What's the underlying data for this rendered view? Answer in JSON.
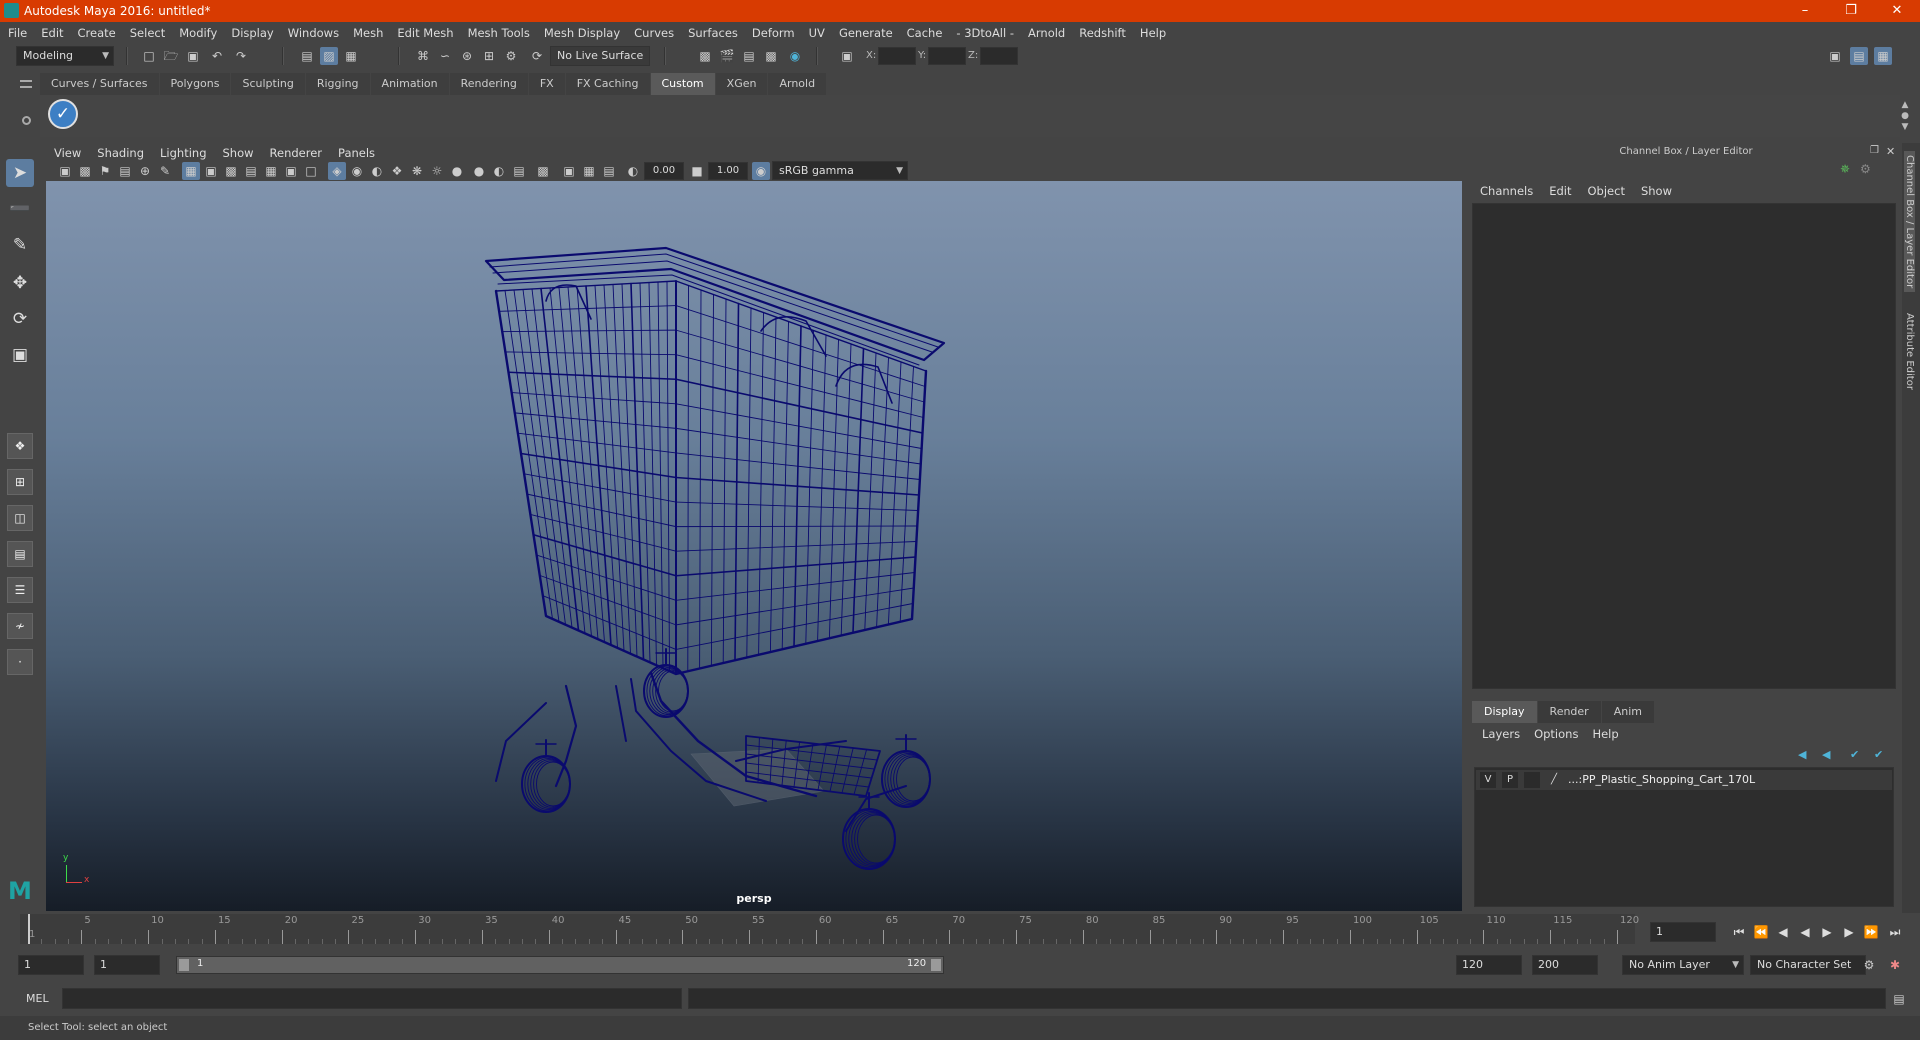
{
  "app": {
    "title": "Autodesk Maya 2016: untitled*"
  },
  "menu": [
    "File",
    "Edit",
    "Create",
    "Select",
    "Modify",
    "Display",
    "Windows",
    "Mesh",
    "Edit Mesh",
    "Mesh Tools",
    "Mesh Display",
    "Curves",
    "Surfaces",
    "Deform",
    "UV",
    "Generate",
    "Cache",
    "- 3DtoAll -",
    "Arnold",
    "Redshift",
    "Help"
  ],
  "status": {
    "mode": "Modeling",
    "live_surface": "No Live Surface",
    "x_label": "X:",
    "y_label": "Y:",
    "z_label": "Z:"
  },
  "shelf": {
    "tabs": [
      "Curves / Surfaces",
      "Polygons",
      "Sculpting",
      "Rigging",
      "Animation",
      "Rendering",
      "FX",
      "FX Caching",
      "Custom",
      "XGen",
      "Arnold"
    ],
    "active_tab": "Custom"
  },
  "viewport": {
    "menu": [
      "View",
      "Shading",
      "Lighting",
      "Show",
      "Renderer",
      "Panels"
    ],
    "exposure": "0.00",
    "gamma": "1.00",
    "color_space": "sRGB gamma",
    "camera": "persp",
    "axis_x": "x",
    "axis_y": "y",
    "wire_color": "#0a0a6e"
  },
  "channel_box": {
    "title": "Channel Box / Layer Editor",
    "menu": [
      "Channels",
      "Edit",
      "Object",
      "Show"
    ],
    "side_tabs": [
      "Channel Box / Layer Editor",
      "Attribute Editor"
    ]
  },
  "layer_editor": {
    "tabs": [
      "Display",
      "Render",
      "Anim"
    ],
    "active_tab": "Display",
    "menu": [
      "Layers",
      "Options",
      "Help"
    ],
    "layer": {
      "v": "V",
      "p": "P",
      "name": "...:PP_Plastic_Shopping_Cart_170L"
    }
  },
  "timeline": {
    "ticks": [
      1,
      5,
      10,
      15,
      20,
      25,
      30,
      35,
      40,
      45,
      50,
      55,
      60,
      65,
      70,
      75,
      80,
      85,
      90,
      95,
      100,
      105,
      110,
      115,
      120
    ],
    "current_frame": "1"
  },
  "range": {
    "start": "1",
    "playback_start": "1",
    "slider_start": "1",
    "slider_end": "120",
    "playback_end": "120",
    "end": "200",
    "anim_layer": "No Anim Layer",
    "character_set": "No Character Set"
  },
  "command": {
    "label": "MEL"
  },
  "help": {
    "text": "Select Tool: select an object"
  }
}
